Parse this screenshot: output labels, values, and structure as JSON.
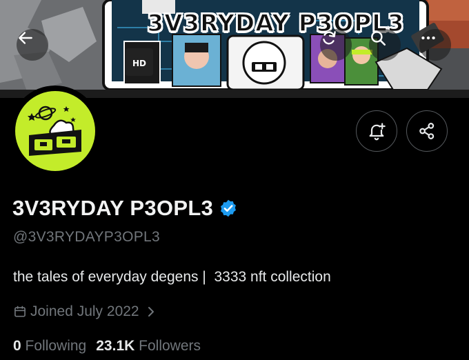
{
  "banner": {
    "title": "3V3RYDAY P3OPL3",
    "card_text": "HD"
  },
  "top_bar": {
    "back_icon": "arrow-left-icon",
    "icons": [
      "refresh-icon",
      "search-icon",
      "more-icon"
    ]
  },
  "actions": {
    "icons": [
      "bell-plus-icon",
      "share-icon"
    ]
  },
  "profile": {
    "display_name": "3V3RYDAY P3OPL3",
    "verified": true,
    "handle": "@3V3RYDAYP3OPL3",
    "bio": "the tales of everyday degens |  3333 nft collection",
    "joined": "Joined July 2022",
    "following_count": "0",
    "following_label": "Following",
    "followers_count": "23.1K",
    "followers_label": "Followers"
  },
  "colors": {
    "background": "#000000",
    "muted_text": "#71767b",
    "verified_blue": "#1d9bf0",
    "avatar_green": "#c3ec2a"
  }
}
